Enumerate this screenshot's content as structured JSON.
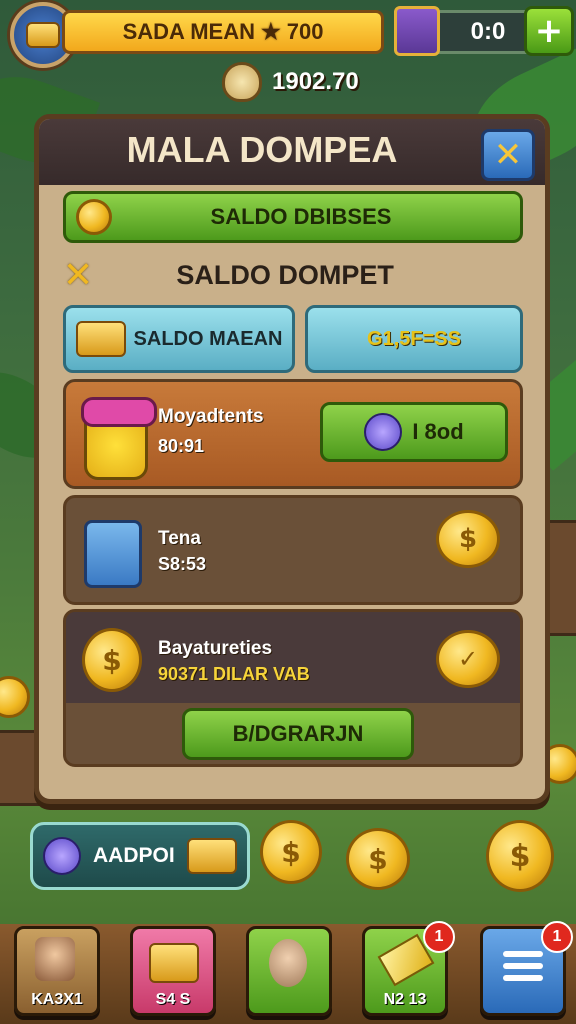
{
  "top_bar": {
    "name": "SADA MEAN",
    "currency": "700",
    "right_counter": "0:0",
    "plus_label": "+",
    "balance": "1902.70"
  },
  "panel": {
    "title": "MALA DOMPEA",
    "close_label": "✕",
    "green_bar_label": "SALDO DBIBSES",
    "section_title": "SALDO DOMPET",
    "section_mark": "✕",
    "tab_left_label": "SALDO MAEAN",
    "tab_right_label": "G1,5F=SS",
    "rows": [
      {
        "name": "Moyadtents",
        "sub": "80:91",
        "button": "I 8od"
      },
      {
        "name": "Tena",
        "sub": "S8:53"
      },
      {
        "name": "Bayatureties",
        "sub": "90371 DILAR VAB"
      }
    ],
    "bottom_button": "B/DGRARJN"
  },
  "bottom_pill": {
    "label": "AADPOI"
  },
  "coins": {
    "symbol": "$"
  },
  "navbar": {
    "items": [
      {
        "label": "KA3X1"
      },
      {
        "label": "S4 S"
      },
      {
        "label": ""
      },
      {
        "label": "N2 13",
        "badge": "1"
      },
      {
        "label": "",
        "badge": "1"
      }
    ]
  },
  "colors": {
    "accent_green": "#4d9a1c",
    "gold": "#f0b821",
    "panel": "#c9b08a",
    "header": "#362a2a"
  }
}
